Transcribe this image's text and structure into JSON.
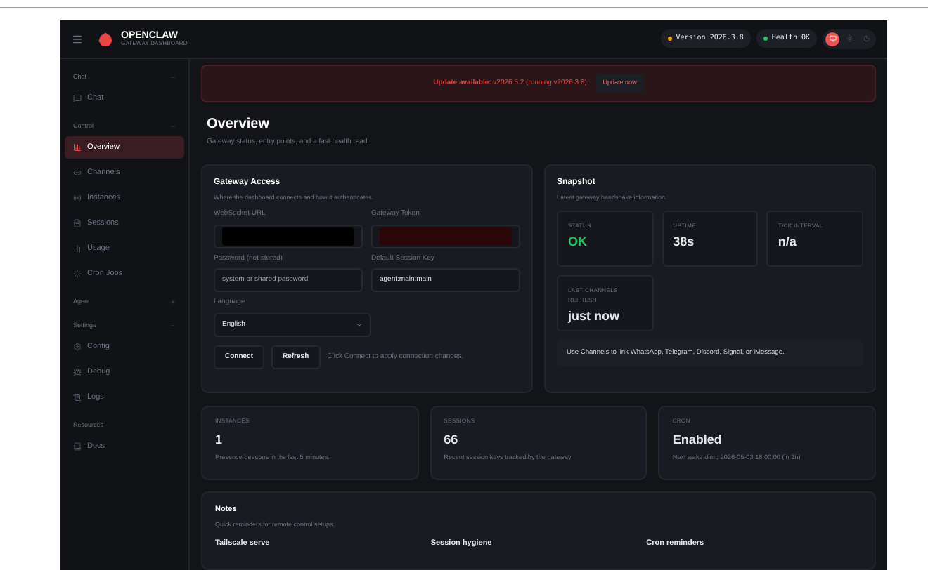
{
  "header": {
    "brand": "OPENCLAW",
    "subtitle": "GATEWAY DASHBOARD",
    "pills": [
      {
        "label": "Version 2026.3.8",
        "color": "#f59e0b"
      },
      {
        "label": "Health OK",
        "color": "#22c55e"
      }
    ],
    "theme_options": [
      {
        "selected": true
      },
      {
        "selected": false
      },
      {
        "selected": false
      }
    ]
  },
  "sidebar": {
    "groups": [
      {
        "label": "Chat",
        "expanded": true,
        "items": [
          {
            "label": "Chat",
            "selected": false
          }
        ]
      },
      {
        "label": "Control",
        "expanded": true,
        "items": [
          {
            "label": "Overview",
            "selected": true
          },
          {
            "label": "Channels",
            "selected": false
          },
          {
            "label": "Instances",
            "selected": false
          },
          {
            "label": "Sessions",
            "selected": false
          },
          {
            "label": "Usage",
            "selected": false
          },
          {
            "label": "Cron Jobs",
            "selected": false
          }
        ]
      },
      {
        "label": "Agent",
        "expanded": false
      },
      {
        "label": "Settings",
        "expanded": true,
        "items": [
          {
            "label": "Config",
            "selected": false
          },
          {
            "label": "Debug",
            "selected": false
          },
          {
            "label": "Logs",
            "selected": false
          }
        ]
      },
      {
        "label": "Resources",
        "items": [
          {
            "label": "Docs",
            "selected": false
          }
        ]
      }
    ]
  },
  "banner": {
    "text": "**Update available:** v2026.5.2 (running v2026.3.8).",
    "button": "Update now"
  },
  "page": {
    "title": "Overview",
    "subtitle": "Gateway status, entry points, and a fast health read."
  },
  "gateway_access": {
    "title": "Gateway Access",
    "subtitle": "Where the dashboard connects and how it authenticates.",
    "fields": [
      {
        "label": "WebSocket URL",
        "redacted": true
      },
      {
        "label": "Gateway Token",
        "redacted": true
      },
      {
        "label": "Password (not stored)",
        "placeholder": "system or shared password"
      },
      {
        "label": "Default Session Key",
        "value": "agent:main:main"
      }
    ],
    "language": {
      "label": "Language",
      "value": "English"
    },
    "buttons": [
      "Connect",
      "Refresh"
    ],
    "hint": "Click Connect to apply connection changes."
  },
  "snapshot": {
    "title": "Snapshot",
    "subtitle": "Latest gateway handshake information.",
    "stats": [
      {
        "label": "STATUS",
        "value": "OK",
        "kind": "ok"
      },
      {
        "label": "UPTIME",
        "value": "38s",
        "kind": "plain"
      },
      {
        "label": "TICK INTERVAL",
        "value": "n/a",
        "kind": "plain"
      },
      {
        "label": "LAST CHANNELS REFRESH",
        "value": "just now",
        "kind": "plain"
      }
    ],
    "note": "Use Channels to link WhatsApp, Telegram, Discord, Signal, or iMessage."
  },
  "summary_cards": [
    {
      "label": "INSTANCES",
      "value": "1",
      "detail": "Presence beacons in the last 5 minutes."
    },
    {
      "label": "SESSIONS",
      "value": "66",
      "detail": "Recent session keys tracked by the gateway."
    },
    {
      "label": "CRON",
      "value": "Enabled",
      "detail": "Next wake dim., 2026-05-03 18:00:00 (in 2h)"
    }
  ],
  "notes": {
    "title": "Notes",
    "subtitle": "Quick reminders for remote control setups.",
    "columns": [
      "Tailscale serve",
      "Session hygiene",
      "Cron reminders"
    ]
  }
}
